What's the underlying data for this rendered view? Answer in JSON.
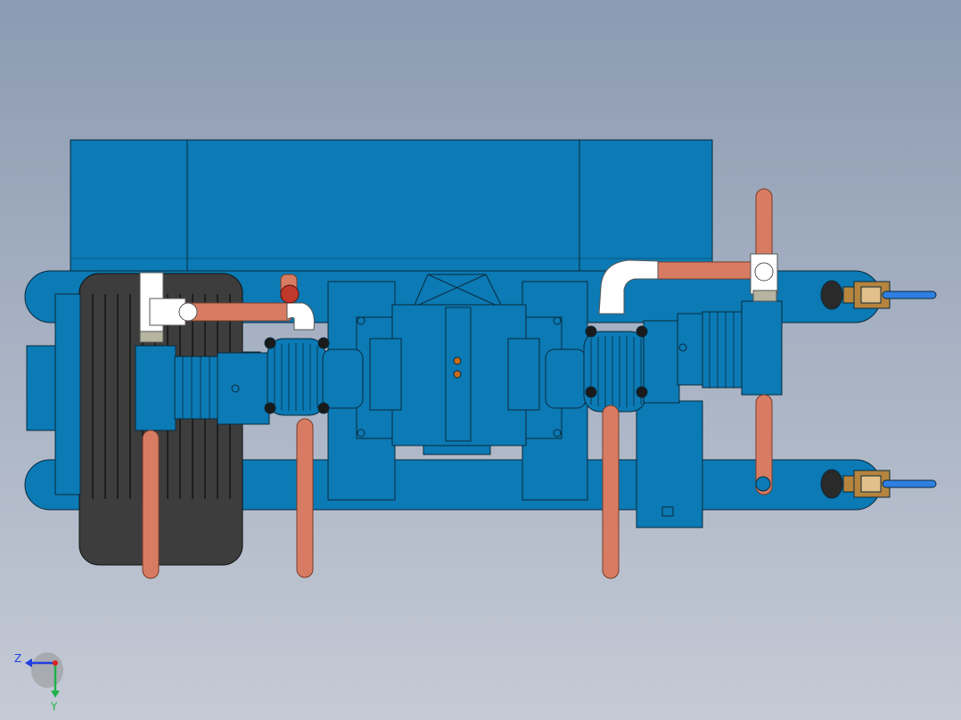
{
  "viewport": {
    "background_top": "#8c9bb2",
    "background_bottom": "#c5cad5"
  },
  "model": {
    "body_color": "#0b7ab5",
    "edge_color": "#0a2a3c",
    "pipe_color": "#d77c63",
    "fitting_color": "#ffffff",
    "motor_color": "#3d3d3d",
    "brass_color": "#b5843e",
    "handle_color": "#2f7fe0"
  },
  "triad": {
    "z_label": "Z",
    "y_label": "Y",
    "z_color": "#1f3fe0",
    "y_color": "#22b14c",
    "x_color": "#e02020"
  }
}
